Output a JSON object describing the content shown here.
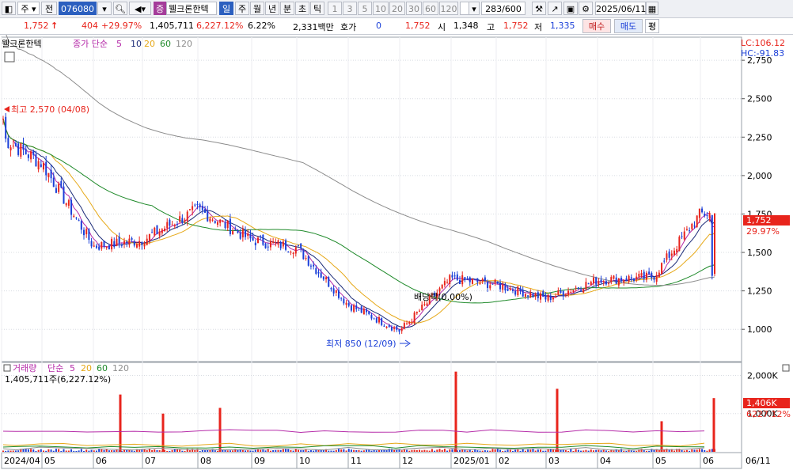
{
  "toolbar": {
    "mode": "주",
    "prev": "전",
    "code": "076080",
    "stock_name": "웰크론한텍",
    "badge": "증",
    "periods": [
      "일",
      "주",
      "월",
      "년",
      "분",
      "초",
      "틱"
    ],
    "active_period": "일",
    "intervals": [
      "1",
      "3",
      "5",
      "10",
      "20",
      "30",
      "60",
      "120"
    ],
    "count": "283/600",
    "date": "2025/06/11"
  },
  "info": {
    "price": "1,752",
    "arrow": "↑",
    "change": "404",
    "change_pct": "+29.97%",
    "volume": "1,405,711",
    "volume_pct": "6,227.12%",
    "turnover": "6.22%",
    "amount": "2,331백만",
    "quote_label": "호가",
    "quote_value": "0",
    "quote_price": "1,752",
    "open_label": "시",
    "open": "1,348",
    "high_label": "고",
    "high": "1,752",
    "low_label": "저",
    "low": "1,335",
    "buy": "매수",
    "sell": "매도",
    "eval": "평"
  },
  "legend_price": {
    "name": "웰크론한텍",
    "type": "종가 단순",
    "ma": [
      "5",
      "10",
      "20",
      "60",
      "120"
    ]
  },
  "legend_volume": {
    "name": "거래량",
    "type": "단순",
    "ma": [
      "5",
      "20",
      "60",
      "120"
    ],
    "value": "1,405,711주(6,227.12%)"
  },
  "annotations": {
    "high": "최고 2,570 (04/08)",
    "low": "최저 850 (12/09)",
    "dividend": "배당락(0.00%)"
  },
  "lc": "LC:106.12",
  "hc": "HC:-91.83",
  "colors": {
    "up": "#e8241c",
    "down": "#1a3fd8",
    "ma5": "#b52aa8",
    "ma10": "#1a2a78",
    "ma20": "#e6a817",
    "ma60": "#1f8a2a",
    "ma120": "#8c8c8c"
  },
  "chart_data": [
    {
      "type": "candlestick",
      "x_start": "2024-04",
      "x_end": "2025-06-11",
      "months": [
        "2024/04",
        "05",
        "06",
        "07",
        "08",
        "09",
        "10",
        "11",
        "12",
        "2025/01",
        "02",
        "03",
        "04",
        "05",
        "06"
      ],
      "end_label": "06/11",
      "yticks": [
        1000,
        1250,
        1500,
        1750,
        2000,
        2250,
        2500,
        2750
      ],
      "ytick_labels": [
        "1,000",
        "1,250",
        "1,500",
        "1,750",
        "2,000",
        "2,250",
        "2,500",
        "2,750"
      ],
      "ylim": [
        790,
        2900
      ],
      "last_close": 1752,
      "last_close_label": "1,752",
      "last_change_label": "29.97%",
      "high": 2570,
      "low": 850,
      "close_by_month": [
        {
          "month": "2024/04",
          "close": 2250
        },
        {
          "month": "05",
          "close": 2080
        },
        {
          "month": "06",
          "close": 1540
        },
        {
          "month": "07",
          "close": 1580
        },
        {
          "month": "08",
          "close": 1780
        },
        {
          "month": "09",
          "close": 1580
        },
        {
          "month": "10",
          "close": 1530
        },
        {
          "month": "11",
          "close": 1160
        },
        {
          "month": "12",
          "close": 990
        },
        {
          "month": "2025/01",
          "close": 1330
        },
        {
          "month": "02",
          "close": 1290
        },
        {
          "month": "03",
          "close": 1200
        },
        {
          "month": "04",
          "close": 1320
        },
        {
          "month": "05",
          "close": 1340
        },
        {
          "month": "06",
          "close": 1752
        }
      ]
    },
    {
      "type": "bar",
      "title": "거래량",
      "yticks": [
        1000000,
        2000000
      ],
      "ytick_labels": [
        "1,000K",
        "2,000K"
      ],
      "last_label": "1,406K",
      "last_pct_label": "6227.12%",
      "spikes": [
        {
          "month": "06",
          "value": 1500000
        },
        {
          "month": "07",
          "value": 1000000
        },
        {
          "month": "08",
          "value": 1150000
        },
        {
          "month": "2025/01",
          "value": 2100000
        },
        {
          "month": "03",
          "value": 1650000
        },
        {
          "month": "05",
          "value": 800000
        },
        {
          "month": "06",
          "value": 1406000
        }
      ]
    }
  ]
}
